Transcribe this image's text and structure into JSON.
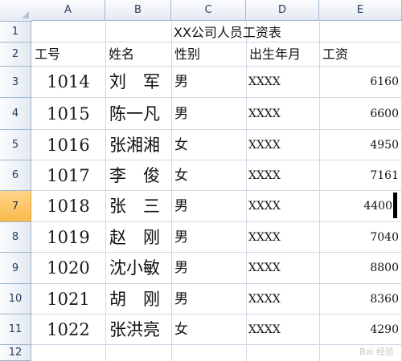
{
  "columns": [
    "A",
    "B",
    "C",
    "D",
    "E"
  ],
  "rows": [
    "1",
    "2",
    "3",
    "4",
    "5",
    "6",
    "7",
    "8",
    "9",
    "10",
    "11",
    "12"
  ],
  "active_row": "7",
  "title": "XX公司人员工资表",
  "headers": {
    "id": "工号",
    "name": "姓名",
    "gender": "性别",
    "birth": "出生年月",
    "salary": "工资"
  },
  "employees": [
    {
      "id": "1014",
      "name": "刘　军",
      "gender": "男",
      "birth": "XXXX",
      "salary": "6160"
    },
    {
      "id": "1015",
      "name": "陈一凡",
      "gender": "男",
      "birth": "XXXX",
      "salary": "6600"
    },
    {
      "id": "1016",
      "name": "张湘湘",
      "gender": "女",
      "birth": "XXXX",
      "salary": "4950"
    },
    {
      "id": "1017",
      "name": "李　俊",
      "gender": "女",
      "birth": "XXXX",
      "salary": "7161"
    },
    {
      "id": "1018",
      "name": "张　三",
      "gender": "男",
      "birth": "XXXX",
      "salary": "4400"
    },
    {
      "id": "1019",
      "name": "赵　刚",
      "gender": "男",
      "birth": "XXXX",
      "salary": "7040"
    },
    {
      "id": "1020",
      "name": "沈小敏",
      "gender": "男",
      "birth": "XXXX",
      "salary": "8800"
    },
    {
      "id": "1021",
      "name": "胡　刚",
      "gender": "男",
      "birth": "XXXX",
      "salary": "8360"
    },
    {
      "id": "1022",
      "name": "张洪亮",
      "gender": "女",
      "birth": "XXXX",
      "salary": "4290"
    }
  ],
  "watermark": "Bai 经验"
}
